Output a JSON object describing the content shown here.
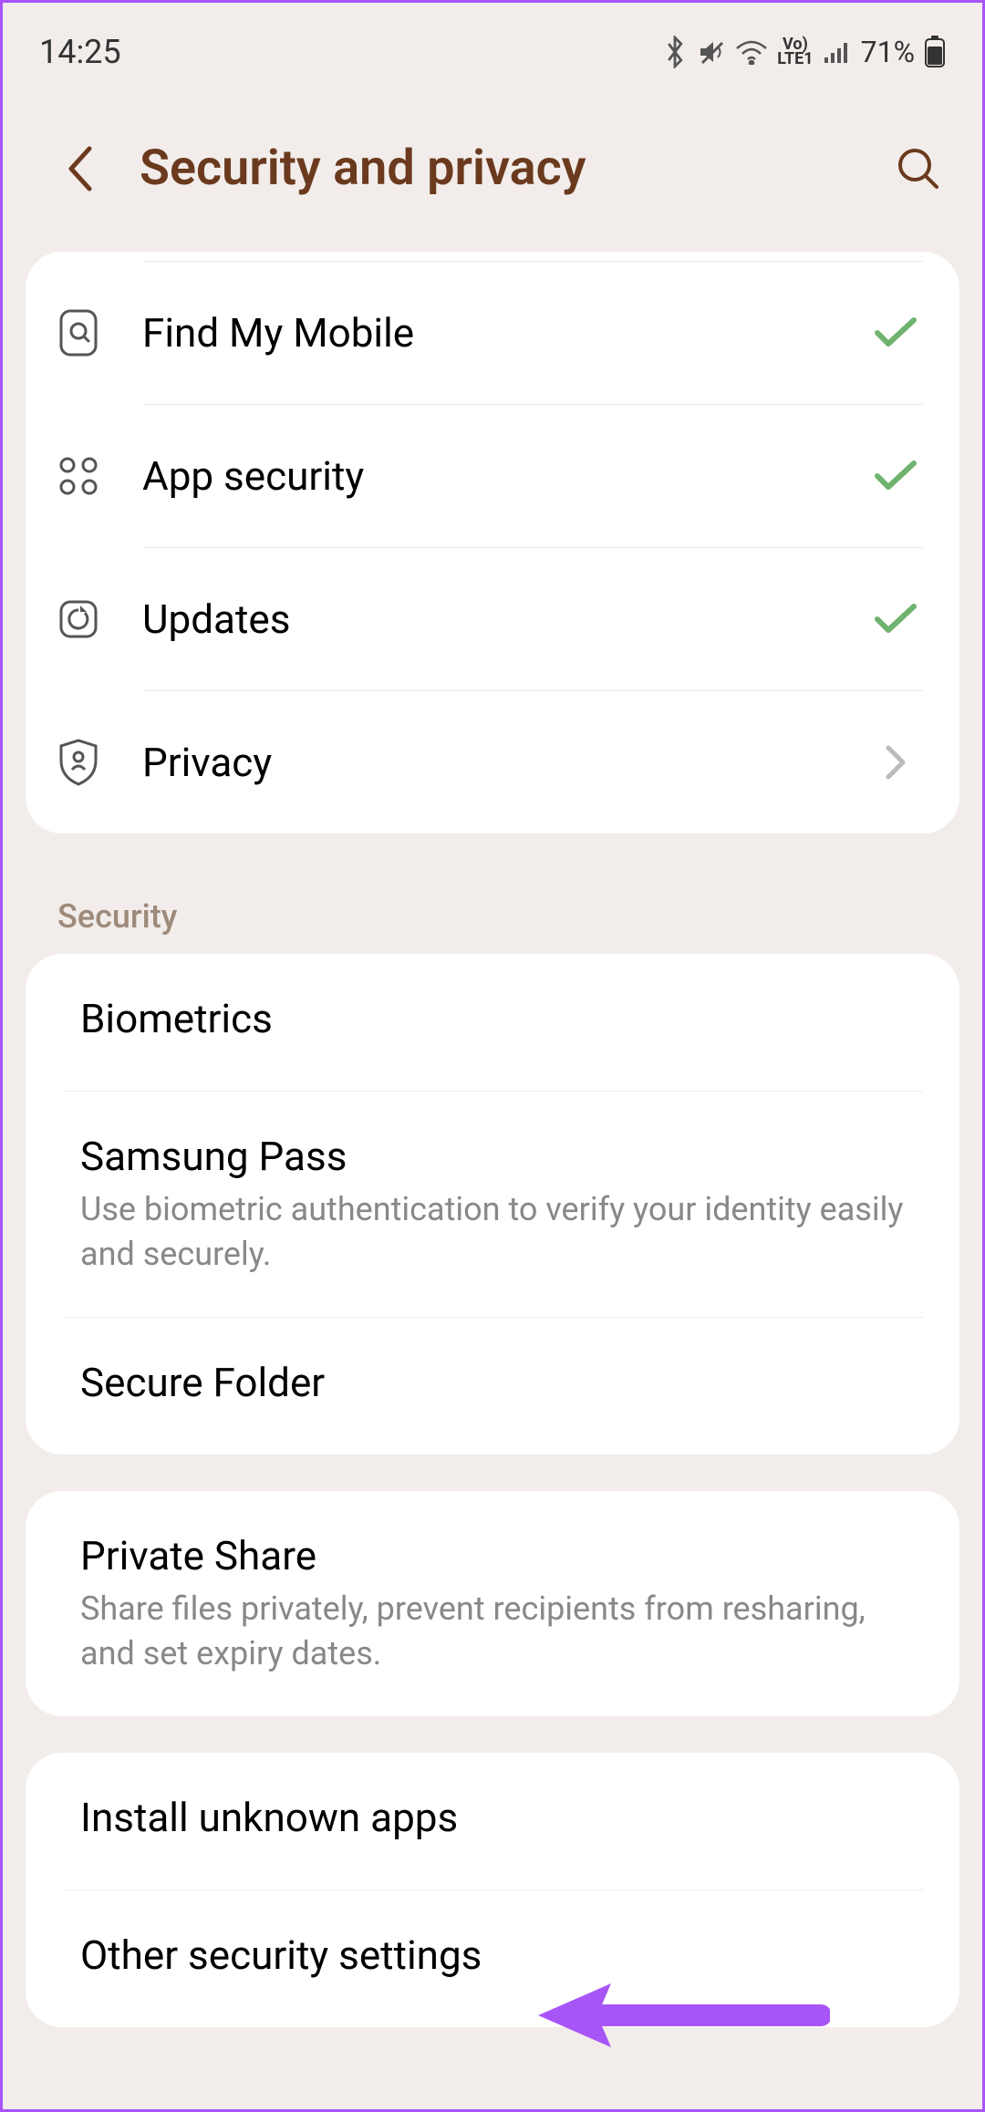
{
  "statusBar": {
    "time": "14:25",
    "batteryPercent": "71%"
  },
  "header": {
    "title": "Security and privacy"
  },
  "quickSettings": [
    {
      "id": "find-my-mobile",
      "label": "Find My Mobile",
      "status": "check"
    },
    {
      "id": "app-security",
      "label": "App security",
      "status": "check"
    },
    {
      "id": "updates",
      "label": "Updates",
      "status": "check"
    },
    {
      "id": "privacy",
      "label": "Privacy",
      "status": "chevron"
    }
  ],
  "sections": {
    "securityHeader": "Security",
    "group1": [
      {
        "title": "Biometrics",
        "subtitle": ""
      },
      {
        "title": "Samsung Pass",
        "subtitle": "Use biometric authentication to verify your identity easily and securely."
      },
      {
        "title": "Secure Folder",
        "subtitle": ""
      }
    ],
    "group2": [
      {
        "title": "Private Share",
        "subtitle": "Share files privately, prevent recipients from resharing, and set expiry dates."
      }
    ],
    "group3": [
      {
        "title": "Install unknown apps",
        "subtitle": ""
      },
      {
        "title": "Other security settings",
        "subtitle": ""
      }
    ]
  }
}
